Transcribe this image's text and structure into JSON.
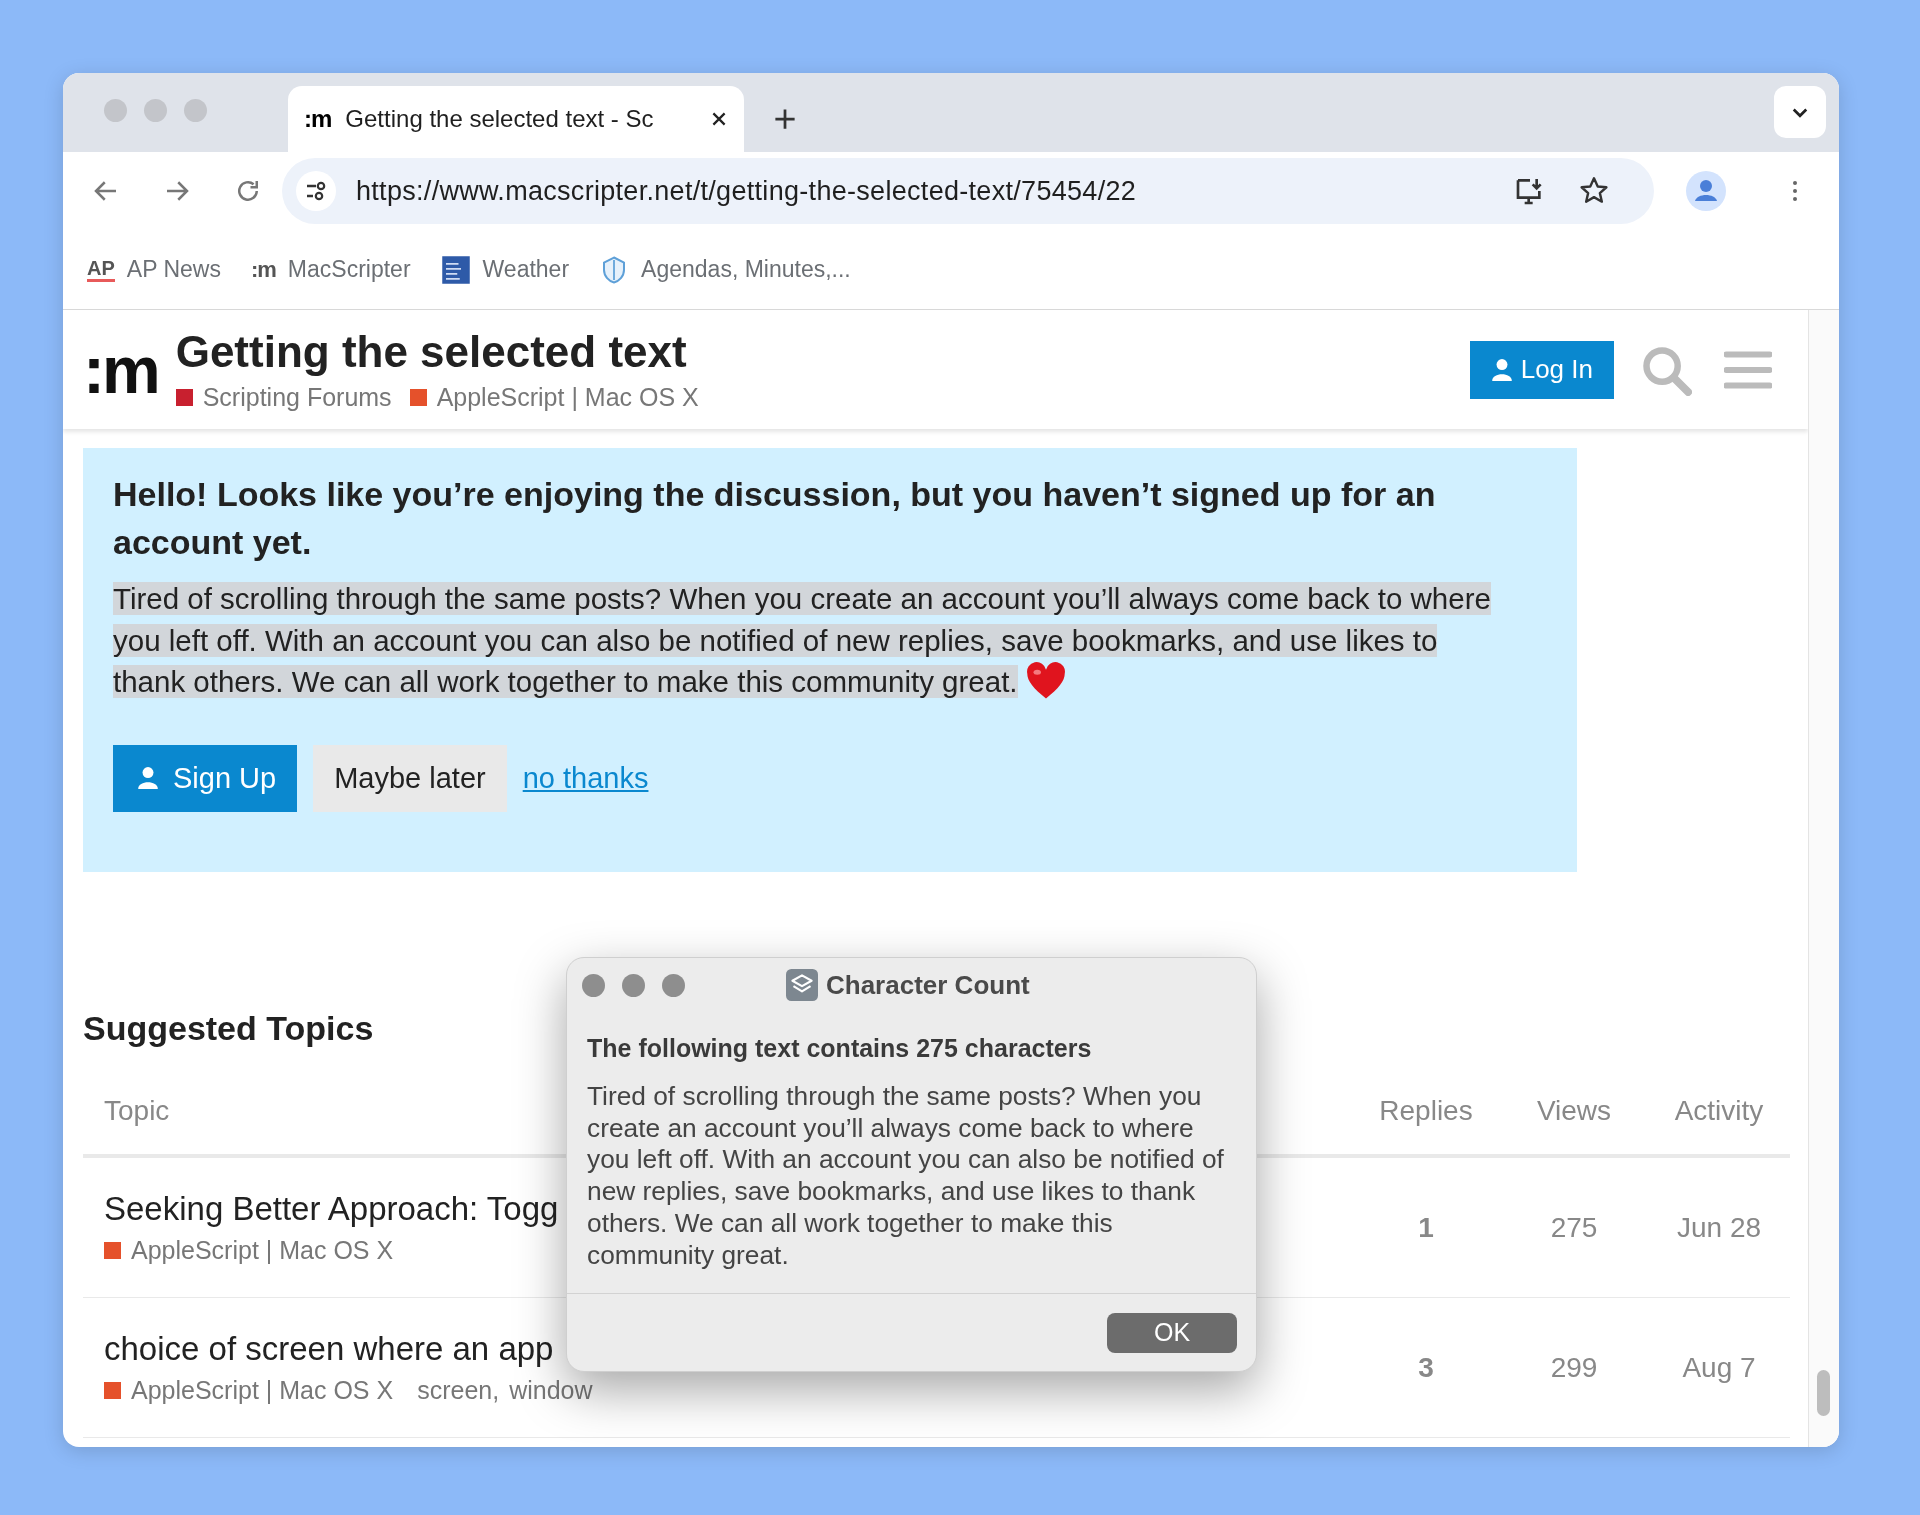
{
  "browser": {
    "tab": {
      "favicon": ":m",
      "title": "Getting the selected text - Sc"
    },
    "url": "https://www.macscripter.net/t/getting-the-selected-text/75454/22",
    "bookmarks": [
      {
        "kind": "ap",
        "badge": "AP",
        "label": "AP News"
      },
      {
        "kind": "m",
        "badge": ":m",
        "label": "MacScripter"
      },
      {
        "kind": "weather",
        "label": "Weather"
      },
      {
        "kind": "shield",
        "label": "Agendas, Minutes,..."
      }
    ]
  },
  "header": {
    "logo": ":m",
    "title": "Getting the selected text",
    "categories": [
      {
        "name": "Scripting Forums",
        "color": "#c8202f"
      },
      {
        "name": "AppleScript | Mac OS X",
        "color": "#e5512b"
      }
    ],
    "login": "Log In"
  },
  "banner": {
    "heading": "Hello! Looks like you’re enjoying the discussion, but you haven’t signed up for an account yet.",
    "text": "Tired of scrolling through the same posts? When you create an account you’ll always come back to where you left off. With an account you can also be notified of new replies, save bookmarks, and use likes to thank others. We can all work together to make this community great.",
    "highlighted": true,
    "signup": "Sign Up",
    "later": "Maybe later",
    "no_thanks": "no thanks"
  },
  "suggested": {
    "heading": "Suggested Topics",
    "columns": [
      "Topic",
      "Replies",
      "Views",
      "Activity"
    ],
    "rows": [
      {
        "title": "Seeking Better Approach: Togg",
        "category": {
          "name": "AppleScript | Mac OS X",
          "color": "#e5512b"
        },
        "tags": [],
        "replies": "1",
        "views": "275",
        "activity": "Jun 28"
      },
      {
        "title": "choice of screen where an app",
        "category": {
          "name": "AppleScript | Mac OS X",
          "color": "#e5512b"
        },
        "tags": [
          "screen,",
          "window"
        ],
        "replies": "3",
        "views": "299",
        "activity": "Aug 7"
      }
    ]
  },
  "dialog": {
    "title": "Character Count",
    "heading": "The following text contains 275 characters",
    "text": "Tired of scrolling through the same posts? When you create an account you’ll always come back to where you left off. With an account you can also be notified of new replies, save bookmarks, and use likes to thank others. We can all work together to make this community great.",
    "ok": "OK"
  }
}
